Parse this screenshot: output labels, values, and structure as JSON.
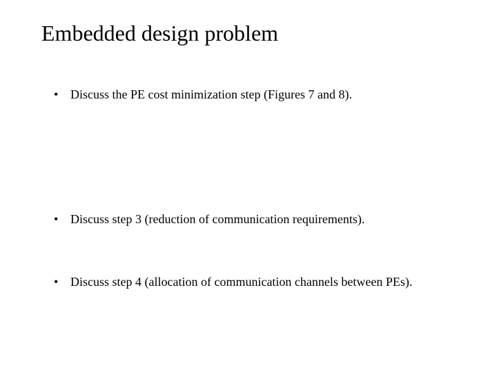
{
  "title": "Embedded design problem",
  "bullets": [
    "Discuss the PE cost minimization step (Figures 7 and 8).",
    "Discuss step 3 (reduction of communication requirements).",
    "Discuss step 4 (allocation of communication channels between PEs)."
  ]
}
